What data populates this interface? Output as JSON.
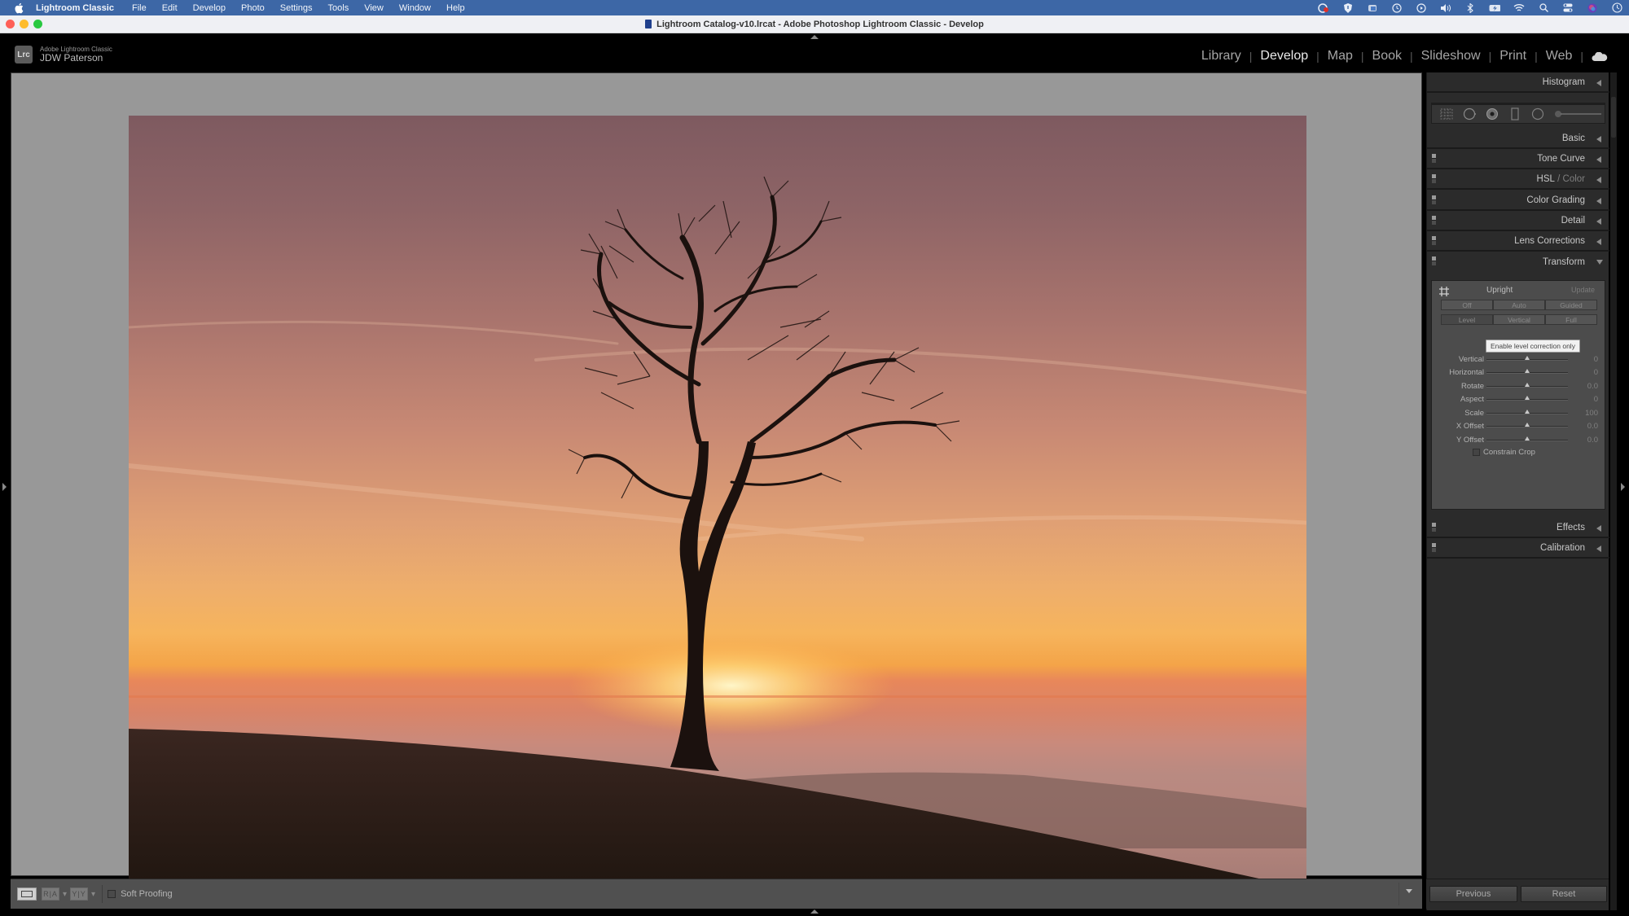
{
  "menubar": {
    "app_name": "Lightroom Classic",
    "items": [
      "File",
      "Edit",
      "Develop",
      "Photo",
      "Settings",
      "Tools",
      "View",
      "Window",
      "Help"
    ],
    "status_icons": [
      "creative-cloud-icon",
      "vpn-shield-icon",
      "screenshot-app-icon",
      "time-machine-icon",
      "play-icon",
      "volume-icon",
      "bluetooth-icon",
      "battery-icon",
      "wifi-icon",
      "spotlight-search-icon",
      "control-center-icon",
      "siri-icon",
      "clock-icon"
    ]
  },
  "window": {
    "title": "Lightroom Catalog-v10.lrcat - Adobe Photoshop Lightroom Classic - Develop"
  },
  "identity": {
    "logo": "Lrc",
    "product": "Adobe Lightroom Classic",
    "user": "JDW Paterson"
  },
  "modules": {
    "items": [
      "Library",
      "Develop",
      "Map",
      "Book",
      "Slideshow",
      "Print",
      "Web"
    ],
    "active": "Develop"
  },
  "photo": {
    "description": "Silhouetted lone tree on a hillside against an orange sunset sky"
  },
  "toolbar": {
    "soft_proofing_label": "Soft Proofing",
    "soft_proofing_checked": false,
    "view_buttons": [
      "loupe-view",
      "before-after-left-right",
      "before-after-top-bottom"
    ]
  },
  "right_panel": {
    "panels": [
      {
        "label": "Histogram",
        "state": "collapsed"
      },
      {
        "label": "Basic",
        "state": "collapsed"
      },
      {
        "label": "Tone Curve",
        "state": "collapsed"
      },
      {
        "label": "HSL",
        "label_dim": "Color",
        "sep": " / ",
        "state": "collapsed"
      },
      {
        "label": "Color Grading",
        "state": "collapsed"
      },
      {
        "label": "Detail",
        "state": "collapsed"
      },
      {
        "label": "Lens Corrections",
        "state": "collapsed"
      },
      {
        "label": "Transform",
        "state": "expanded"
      },
      {
        "label": "Effects",
        "state": "collapsed"
      },
      {
        "label": "Calibration",
        "state": "collapsed"
      }
    ],
    "tool_strip": [
      "crop-overlay-icon",
      "spot-removal-icon",
      "red-eye-icon",
      "masking-icon",
      "radial-icon",
      "slider-icon"
    ],
    "transform": {
      "upright_label": "Upright",
      "update_label": "Update",
      "upright_buttons_row1": [
        "Off",
        "Auto",
        "Guided"
      ],
      "upright_buttons_row2": [
        "Level",
        "Vertical",
        "Full"
      ],
      "tooltip": "Enable level correction only",
      "sliders": [
        {
          "label": "Vertical",
          "value": "0",
          "position": 0.5
        },
        {
          "label": "Horizontal",
          "value": "0",
          "position": 0.5
        },
        {
          "label": "Rotate",
          "value": "0.0",
          "position": 0.5
        },
        {
          "label": "Aspect",
          "value": "0",
          "position": 0.5
        },
        {
          "label": "Scale",
          "value": "100",
          "position": 0.5
        },
        {
          "label": "X Offset",
          "value": "0.0",
          "position": 0.5
        },
        {
          "label": "Y Offset",
          "value": "0.0",
          "position": 0.5
        }
      ],
      "constrain_crop_label": "Constrain Crop",
      "constrain_crop_checked": false
    },
    "buttons": {
      "previous": "Previous",
      "reset": "Reset"
    }
  }
}
